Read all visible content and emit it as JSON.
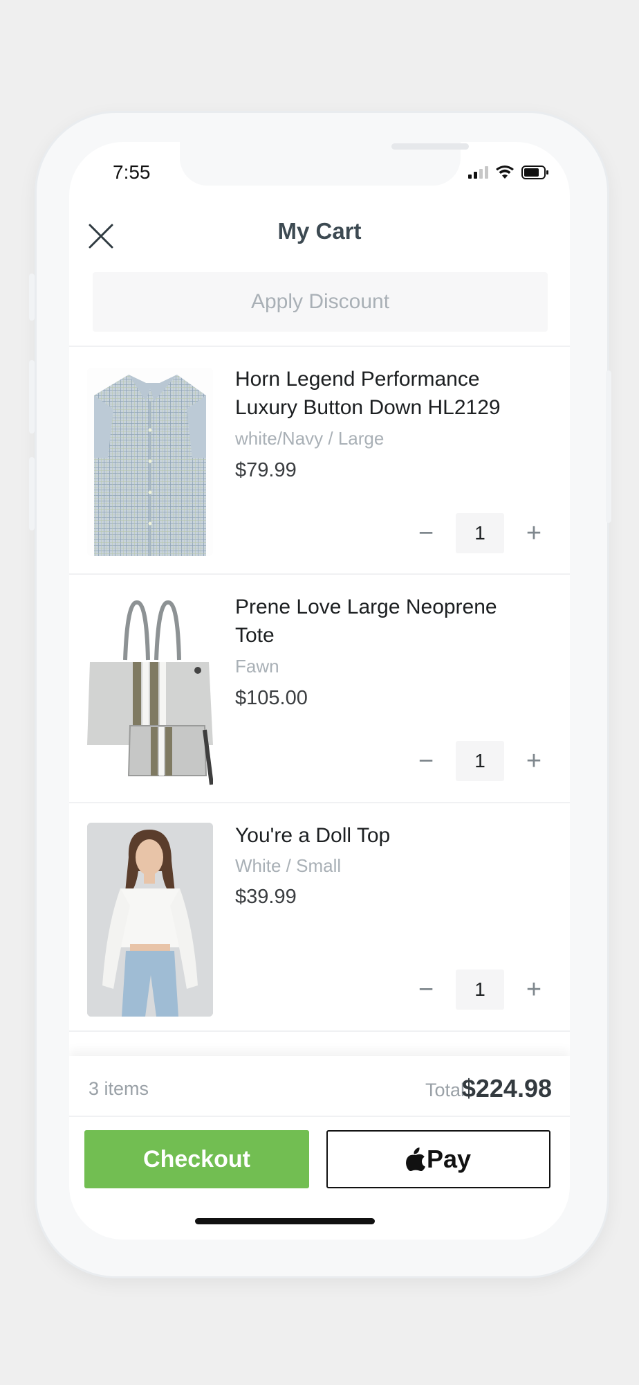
{
  "status_bar": {
    "time": "7:55"
  },
  "header": {
    "title": "My Cart",
    "close_icon": "close-icon"
  },
  "discount": {
    "label": "Apply Discount"
  },
  "items": [
    {
      "name": "Horn Legend Performance Luxury Button Down HL2129",
      "variant": "white/Navy / Large",
      "price": "$79.99",
      "quantity": "1",
      "minus": "−",
      "plus": "+"
    },
    {
      "name": "Prene Love Large Neoprene Tote",
      "variant": "Fawn",
      "price": "$105.00",
      "quantity": "1",
      "minus": "−",
      "plus": "+"
    },
    {
      "name": "You're a Doll Top",
      "variant": "White / Small",
      "price": "$39.99",
      "quantity": "1",
      "minus": "−",
      "plus": "+"
    }
  ],
  "summary": {
    "items_count": "3 items",
    "total_label": "Total",
    "total_value": "$224.98"
  },
  "actions": {
    "checkout_label": "Checkout",
    "applepay_label": "Pay"
  },
  "colors": {
    "checkout_green": "#72be52",
    "title_text": "#3d4a52",
    "muted_text": "#a9b0b6"
  }
}
